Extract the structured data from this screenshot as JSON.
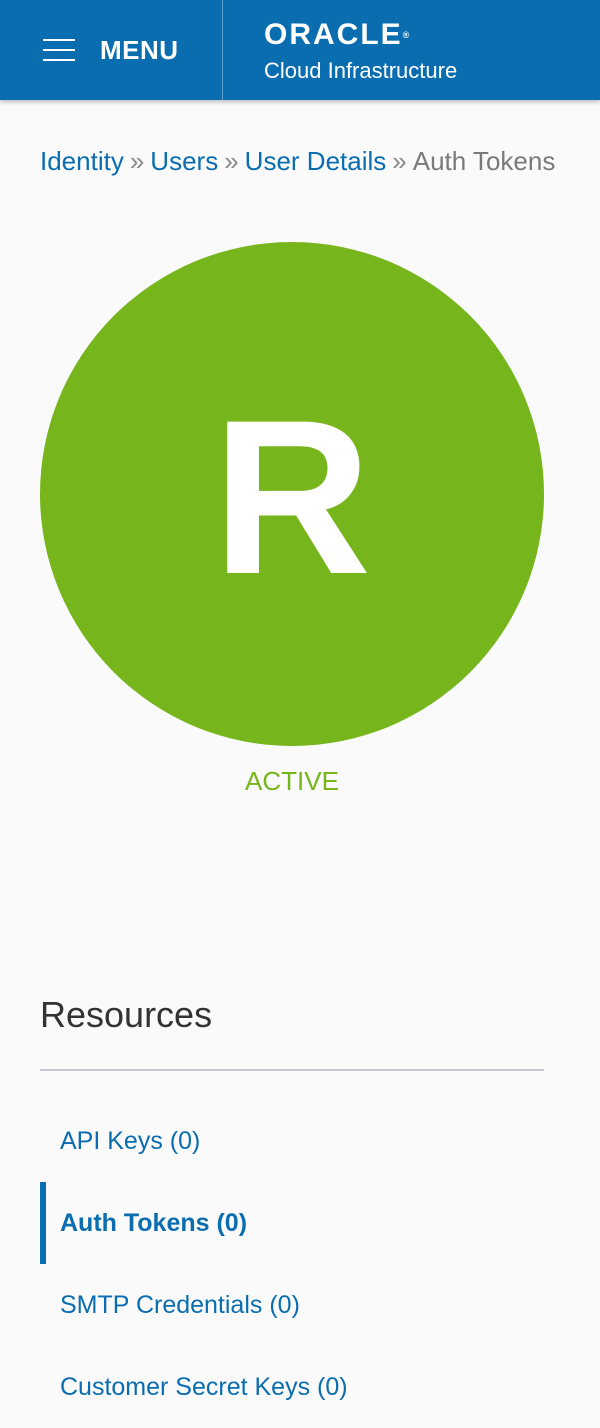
{
  "header": {
    "menu_label": "MENU",
    "brand_name": "ORACLE",
    "brand_reg": "®",
    "brand_subtitle": "Cloud Infrastructure",
    "bg_color": "#0a6db0"
  },
  "breadcrumb": {
    "items": [
      {
        "label": "Identity"
      },
      {
        "label": "Users"
      },
      {
        "label": "User Details"
      }
    ],
    "separator": "»",
    "current": "Auth Tokens"
  },
  "user": {
    "avatar_letter": "R",
    "avatar_color": "#76b51b",
    "status": "ACTIVE"
  },
  "resources": {
    "title": "Resources",
    "items": [
      {
        "label": "API Keys (0)",
        "active": false
      },
      {
        "label": "Auth Tokens (0)",
        "active": true
      },
      {
        "label": "SMTP Credentials (0)",
        "active": false
      },
      {
        "label": "Customer Secret Keys (0)",
        "active": false
      }
    ]
  }
}
